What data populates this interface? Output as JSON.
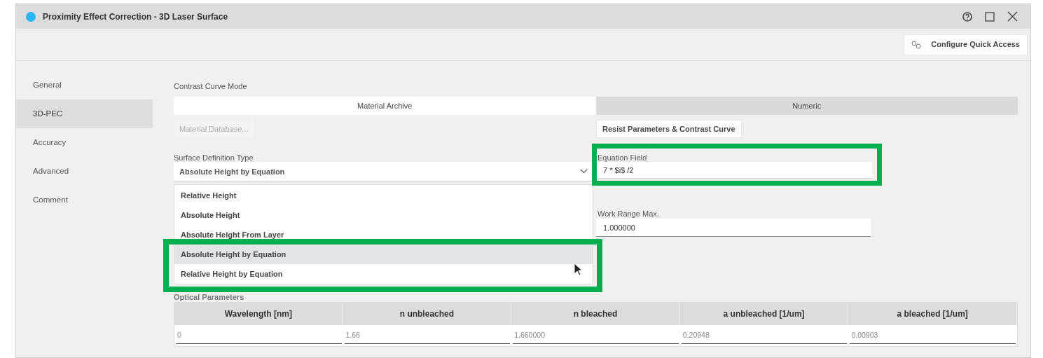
{
  "window": {
    "title": "Proximity Effect Correction - 3D Laser Surface"
  },
  "toolbar": {
    "button": "Configure Quick Access"
  },
  "sidebar": {
    "items": [
      {
        "label": "General",
        "selected": false
      },
      {
        "label": "3D-PEC",
        "selected": true
      },
      {
        "label": "Accuracy",
        "selected": false
      },
      {
        "label": "Advanced",
        "selected": false
      },
      {
        "label": "Comment",
        "selected": false
      }
    ]
  },
  "contrast_curve_mode": {
    "label": "Contrast Curve Mode",
    "tabs": [
      {
        "label": "Material Archive",
        "selected": true
      },
      {
        "label": "Numeric",
        "selected": false
      }
    ]
  },
  "buttons": [
    {
      "label": "Material Database...",
      "disabled": true
    },
    {
      "label": "Resist Parameters & Contrast Curve",
      "disabled": false
    }
  ],
  "surface_definition_type": {
    "label": "Surface Definition Type",
    "value": "Absolute Height by Equation",
    "expanded": true,
    "options": [
      {
        "label": "Relative Height",
        "selected": false
      },
      {
        "label": "Absolute Height",
        "selected": false
      },
      {
        "label": "Absolute Height From Layer",
        "selected": false
      },
      {
        "label": "Absolute Height by Equation",
        "selected": true
      },
      {
        "label": "Relative Height by Equation",
        "selected": false
      }
    ]
  },
  "equation_field": {
    "label": "Equation Field",
    "value": "7 * $i$ /2"
  },
  "work_range_max": {
    "label": "Work Range Max.",
    "value": "1.000000"
  },
  "optical_parameters": {
    "label": "Optical Parameters",
    "columns": [
      "Wavelength [nm]",
      "n unbleached",
      "n bleached",
      "a unbleached [1/um]",
      "a bleached [1/um]"
    ],
    "rows": [
      [
        "0",
        "1.66",
        "1.660000",
        "0.20948",
        "0.00903"
      ]
    ]
  }
}
